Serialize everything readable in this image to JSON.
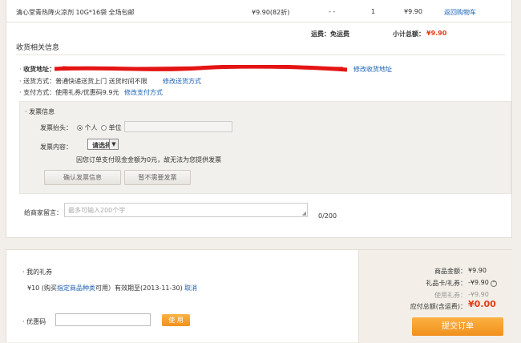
{
  "product": {
    "name": "清心堂青热降火凉剂 10G*16袋 全场包邮",
    "price": "¥9.90(82折)",
    "discount": "- -",
    "qty": "1",
    "subtotal": "¥9.90",
    "back_to_cart": "返回购物车"
  },
  "shipping_summary": {
    "freight": "运费：免运费",
    "subtotal_label": "小计总额：",
    "subtotal_value": "¥9.90"
  },
  "receiver": {
    "section_title": "收货相关信息",
    "address_label": "收货地址：",
    "address_value": "",
    "modify_address": "修改收货地址",
    "delivery_label": "送货方式：",
    "delivery_value": "普通快递送货上门  送货时间不限",
    "modify_delivery": "修改送货方式",
    "payment_label": "支付方式：",
    "payment_value": "使用礼券/优惠码9.9元",
    "modify_payment": "修改支付方式"
  },
  "invoice": {
    "title": "发票信息",
    "header_label": "发票抬头：",
    "personal": "个人",
    "company": "单位",
    "company_input_value": "",
    "content_label": "发票内容：",
    "content_select": "请选择",
    "notice": "因您订单支付现金金额为0元，故无法为您提供发票",
    "confirm_btn": "确认发票信息",
    "no_need_btn": "暂不需要发票"
  },
  "message": {
    "label": "给商家留言：",
    "placeholder": "最多可输入200个字",
    "counter": "0/200"
  },
  "gift": {
    "title": "我的礼券",
    "coupon_amount": "¥10",
    "coupon_desc_prefix": "(购买",
    "coupon_link": "指定商品种类",
    "coupon_desc_suffix": "可用）有效期至(2013-11-30)",
    "cancel": "取消"
  },
  "promo": {
    "label": "优惠码",
    "input_value": "",
    "use_btn": "使 用"
  },
  "summary": {
    "goods_label": "商品金额：",
    "goods_value": "¥9.90",
    "giftcard_label": "礼品卡/礼券：",
    "giftcard_value": "-¥9.90",
    "used_coupon_label": "使用礼券：",
    "used_coupon_value": "-¥9.90",
    "total_label": "应付总额(含运费)：",
    "total_value": "¥0.00",
    "submit_btn": "提交订单"
  },
  "colors": {
    "accent_orange": "#f0901c",
    "price_red": "#e23d18",
    "link_blue": "#1a5fb4",
    "redaction_red": "#e41414"
  }
}
